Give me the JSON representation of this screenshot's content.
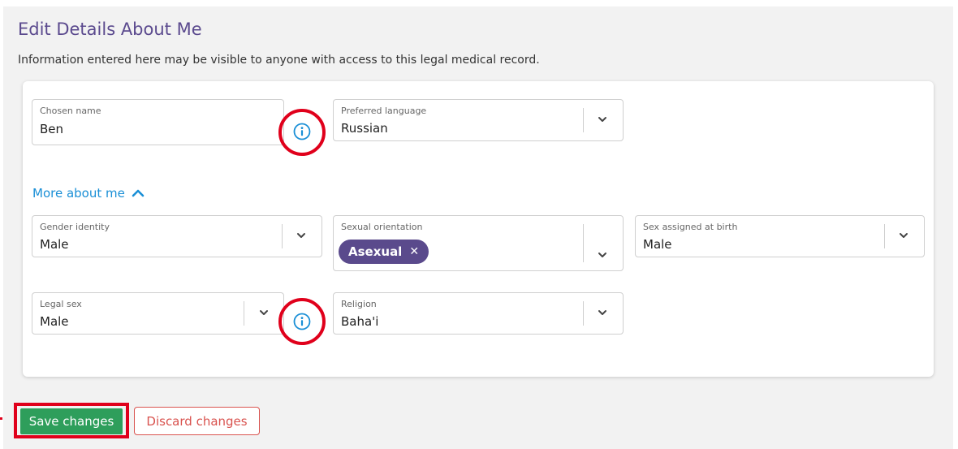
{
  "header": {
    "title": "Edit Details About Me",
    "subtitle": "Information entered here may be visible to anyone with access to this legal medical record."
  },
  "fields": {
    "chosen_name": {
      "label": "Chosen name",
      "value": "Ben"
    },
    "preferred_language": {
      "label": "Preferred language",
      "value": "Russian"
    },
    "gender_identity": {
      "label": "Gender identity",
      "value": "Male"
    },
    "sexual_orientation": {
      "label": "Sexual orientation",
      "chip": "Asexual",
      "chip_remove": "✕"
    },
    "sex_assigned_at_birth": {
      "label": "Sex assigned at birth",
      "value": "Male"
    },
    "legal_sex": {
      "label": "Legal sex",
      "value": "Male"
    },
    "religion": {
      "label": "Religion",
      "value": "Baha'i"
    }
  },
  "more_about_me": {
    "label": "More about me"
  },
  "actions": {
    "save_label": "Save changes",
    "discard_label": "Discard changes"
  },
  "icons": {
    "info": "info-circle-icon",
    "chevron_down": "chevron-down-icon",
    "chevron_up": "chevron-up-icon"
  },
  "colors": {
    "title": "#5b4a8e",
    "link": "#1a8fd6",
    "chip": "#5a4a8c",
    "save": "#2e9e5b",
    "discard": "#d9534f",
    "highlight": "#e0001b"
  }
}
